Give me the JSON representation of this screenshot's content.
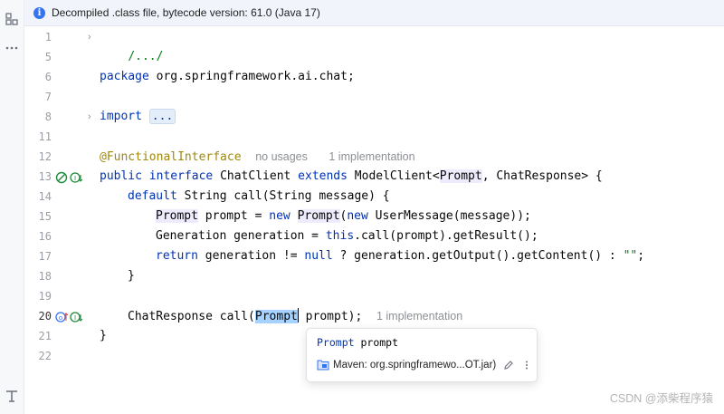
{
  "banner": {
    "text": "Decompiled .class file, bytecode version: 61.0 (Java 17)"
  },
  "gutter": {
    "line_numbers": [
      "1",
      "5",
      "6",
      "7",
      "8",
      "11",
      "12",
      "13",
      "14",
      "15",
      "16",
      "17",
      "18",
      "19",
      "20",
      "21",
      "22"
    ]
  },
  "code": {
    "l1": "/.../",
    "l6_kw": "package",
    "l6_rest": " org.springframework.ai.chat;",
    "l8_kw": "import",
    "l8_dots": "...",
    "l12_ann": "@FunctionalInterface",
    "l12_hint1": "no usages",
    "l12_hint2": "1 implementation",
    "l13_kw1": "public",
    "l13_kw2": "interface",
    "l13_name": " ChatClient ",
    "l13_kw3": "extends",
    "l13_a": " ModelClient<",
    "l13_prompt": "Prompt",
    "l13_b": ", ChatResponse> {",
    "l14_kw": "default",
    "l14_rest": " String call(String message) {",
    "l15_prompt": "Prompt",
    "l15_a": " prompt = ",
    "l15_new1": "new",
    "l15_prompt2": "Prompt",
    "l15_b": "(",
    "l15_new2": "new",
    "l15_c": " UserMessage(message));",
    "l16_a": "Generation generation = ",
    "l16_this": "this",
    "l16_b": ".call(prompt).getResult();",
    "l17_kw": "return",
    "l17_a": " generation != ",
    "l17_null": "null",
    "l17_b": " ? generation.getOutput().getContent() : ",
    "l17_str": "\"\"",
    "l17_c": ";",
    "l18": "}",
    "l20_a": "ChatResponse call(",
    "l20_sel": "Prompt",
    "l20_b": " prompt);",
    "l20_hint": "1 implementation",
    "l21": "}"
  },
  "popup": {
    "sig_type": "Prompt",
    "sig_name": " prompt",
    "source": "Maven: org.springframewo...OT.jar)"
  },
  "watermark": "CSDN @添柴程序猿",
  "colors": {
    "keyword": "#0033b3",
    "annotation": "#9e880d",
    "string": "#067d17",
    "selection": "#a6d2ff",
    "info": "#3574f0"
  }
}
